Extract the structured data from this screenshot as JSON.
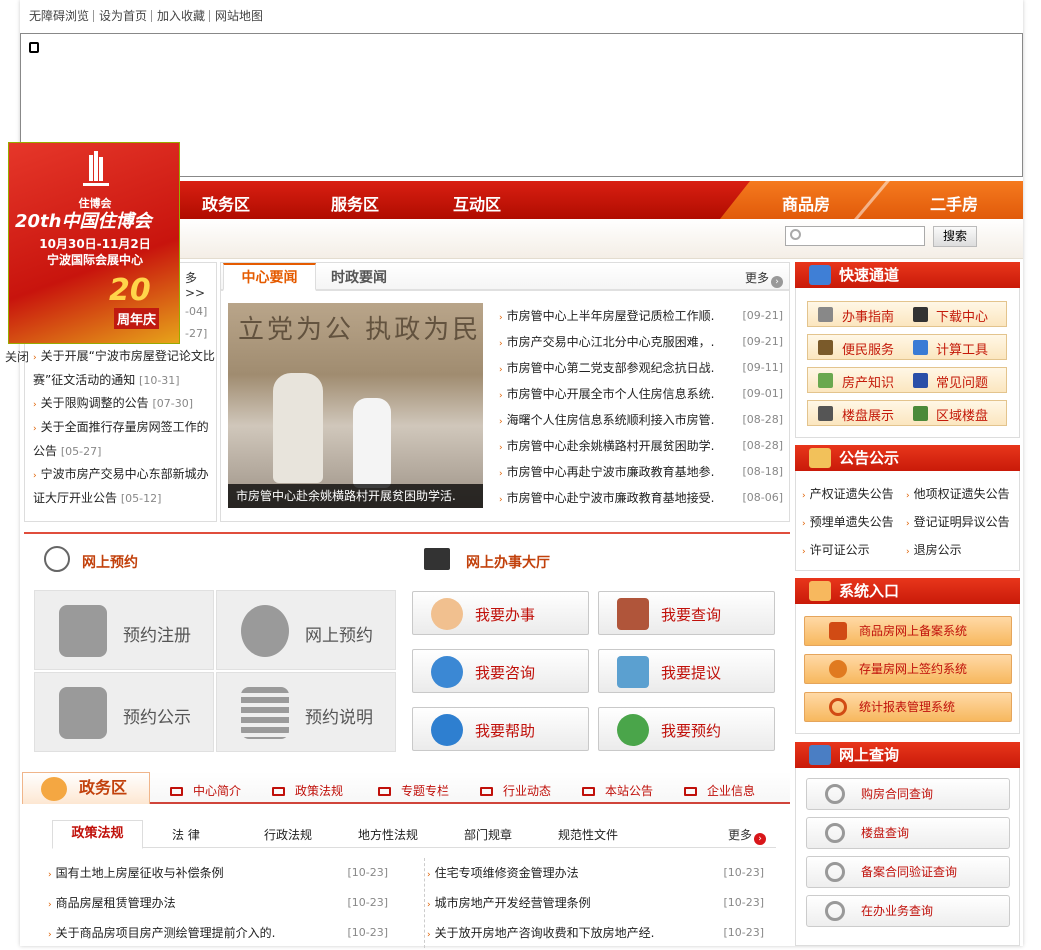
{
  "top_links": [
    "无障碍浏览",
    "设为首页",
    "加入收藏",
    "网站地图"
  ],
  "nav": {
    "items": [
      "政务区",
      "服务区",
      "互动区"
    ],
    "right": [
      "商品房",
      "二手房"
    ]
  },
  "search": {
    "button": "搜索",
    "placeholder": ""
  },
  "ad": {
    "org": "住博会",
    "edition": "20th中国住博会",
    "date": "10月30日-11月2日",
    "venue": "宁波国际会展中心",
    "anniv": "20",
    "anniv_text": "周年庆",
    "close": "关闭"
  },
  "left_box": {
    "more": "多>>",
    "partial_dates": [
      "-04]",
      "-27]"
    ],
    "items": [
      {
        "title": "关于开展“宁波市房屋登记论文比赛”征文活动的通知",
        "date": "[10-31]"
      },
      {
        "title": "关于限购调整的公告",
        "date": "[07-30]"
      },
      {
        "title": "关于全面推行存量房网签工作的公告",
        "date": "[05-27]"
      },
      {
        "title": "宁波市房产交易中心东部新城办证大厅开业公告",
        "date": "[05-12]"
      }
    ]
  },
  "news": {
    "tabs": [
      "中心要闻",
      "时政要闻"
    ],
    "more": "更多",
    "photo_caption": "市房管中心赴余姚横路村开展贫困助学活.",
    "photo_text": "立党为公 执政为民",
    "items": [
      {
        "title": "市房管中心上半年房屋登记质检工作顺.",
        "date": "[09-21]"
      },
      {
        "title": "市房产交易中心江北分中心克服困难，.",
        "date": "[09-21]"
      },
      {
        "title": "市房管中心第二党支部参观纪念抗日战.",
        "date": "[09-11]"
      },
      {
        "title": "市房管中心开展全市个人住房信息系统.",
        "date": "[09-01]"
      },
      {
        "title": "海曙个人住房信息系统顺利接入市房管.",
        "date": "[08-28]"
      },
      {
        "title": "市房管中心赴余姚横路村开展贫困助学.",
        "date": "[08-28]"
      },
      {
        "title": "市房管中心再赴宁波市廉政教育基地参.",
        "date": "[08-18]"
      },
      {
        "title": "市房管中心赴宁波市廉政教育基地接受.",
        "date": "[08-06]"
      }
    ]
  },
  "quick": {
    "title": "快速通道",
    "items": [
      "办事指南",
      "下载中心",
      "便民服务",
      "计算工具",
      "房产知识",
      "常见问题",
      "楼盘展示",
      "区域楼盘"
    ]
  },
  "notice": {
    "title": "公告公示",
    "items": [
      "产权证遗失公告",
      "他项权证遗失公告",
      "预埋单遗失公告",
      "登记证明异议公告",
      "许可证公示",
      "退房公示"
    ]
  },
  "system": {
    "title": "系统入口",
    "items": [
      "商品房网上备案系统",
      "存量房网上签约系统",
      "统计报表管理系统"
    ]
  },
  "query": {
    "title": "网上查询",
    "items": [
      "购房合同查询",
      "楼盘查询",
      "备案合同验证查询",
      "在办业务查询"
    ]
  },
  "appointment": {
    "title": "网上预约",
    "tiles": [
      "预约注册",
      "网上预约",
      "预约公示",
      "预约说明"
    ]
  },
  "hall": {
    "title": "网上办事大厅",
    "buttons": [
      "我要办事",
      "我要查询",
      "我要咨询",
      "我要提议",
      "我要帮助",
      "我要预约"
    ]
  },
  "gov": {
    "title": "政务区",
    "tabs": [
      "中心简介",
      "政策法规",
      "专题专栏",
      "行业动态",
      "本站公告",
      "企业信息"
    ],
    "sub_tabs": [
      "政策法规",
      "法 律",
      "行政法规",
      "地方性法规",
      "部门规章",
      "规范性文件"
    ],
    "more": "更多",
    "left": [
      {
        "title": "国有土地上房屋征收与补偿条例",
        "date": "[10-23]"
      },
      {
        "title": "商品房屋租赁管理办法",
        "date": "[10-23]"
      },
      {
        "title": "关于商品房项目房产测绘管理提前介入的.",
        "date": "[10-23]"
      }
    ],
    "right": [
      {
        "title": "住宅专项维修资金管理办法",
        "date": "[10-23]"
      },
      {
        "title": "城市房地产开发经营管理条例",
        "date": "[10-23]"
      },
      {
        "title": "关于放开房地产咨询收费和下放房地产经.",
        "date": "[10-23]"
      }
    ]
  },
  "colors": {
    "nav_red": "#c8150a",
    "accent_orange": "#e55b00",
    "link_red": "#c0100a"
  }
}
